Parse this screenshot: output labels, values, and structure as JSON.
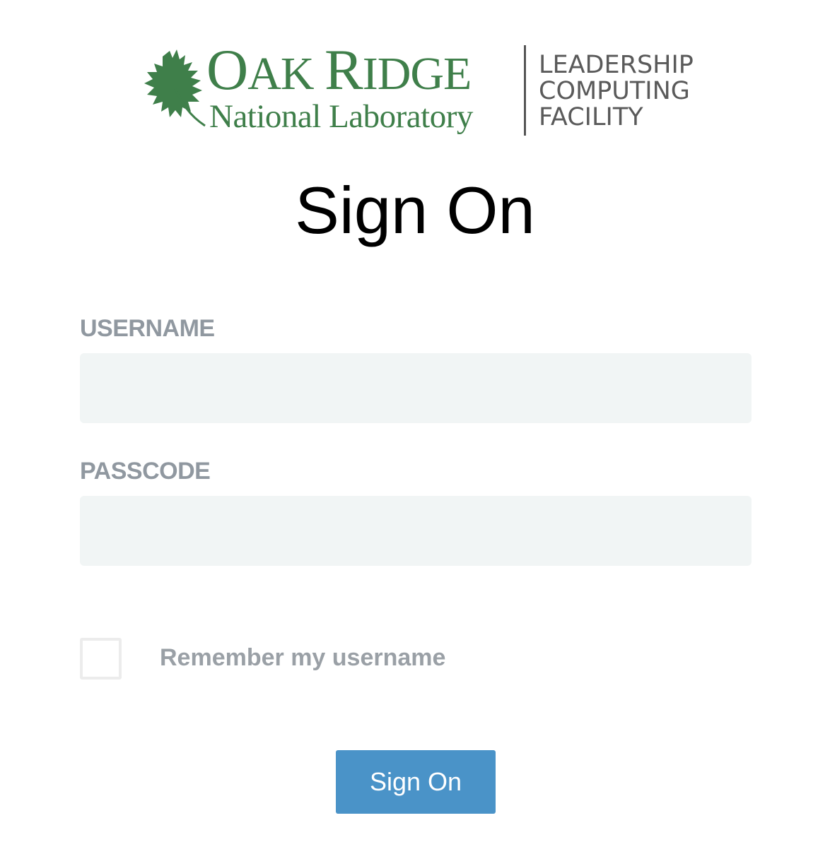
{
  "logo": {
    "org_name_line1_big1": "O",
    "org_name_line1_small1": "AK ",
    "org_name_line1_big2": "R",
    "org_name_line1_small2": "IDGE",
    "org_name_line2": "National Laboratory",
    "facility_line1": "LEADERSHIP",
    "facility_line2": "COMPUTING",
    "facility_line3": "FACILITY",
    "brand_color": "#3f7f4a"
  },
  "title": "Sign On",
  "form": {
    "username_label": "USERNAME",
    "username_value": "",
    "passcode_label": "PASSCODE",
    "passcode_value": "",
    "remember_label": "Remember my username",
    "remember_checked": false,
    "submit_label": "Sign On",
    "submit_color": "#4a93c8",
    "input_bg_color": "#f1f5f5"
  }
}
